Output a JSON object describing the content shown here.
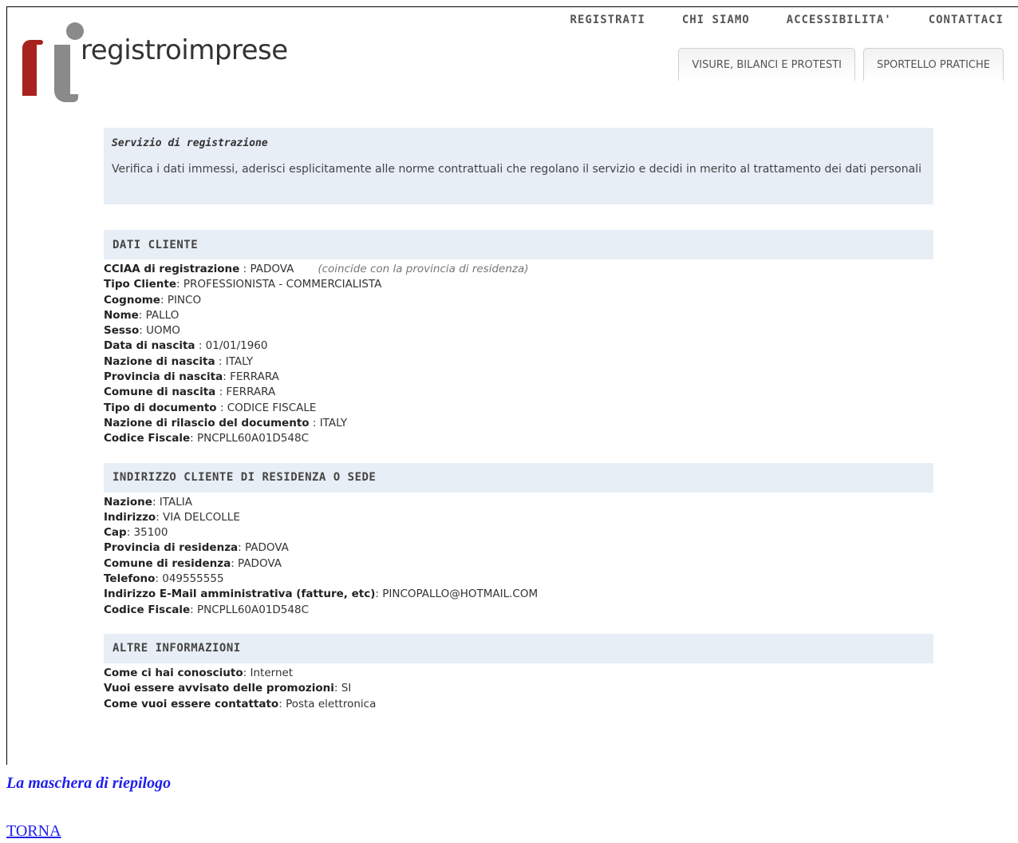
{
  "logo": {
    "text": "registroimprese",
    "colors": {
      "red": "#a8231e",
      "grey": "#8a8a8a"
    }
  },
  "topnav": [
    "REGISTRATI",
    "CHI SIAMO",
    "ACCESSIBILITA'",
    "CONTATTACI"
  ],
  "tabs": [
    "VISURE, BILANCI E PROTESTI",
    "SPORTELLO PRATICHE"
  ],
  "intro": {
    "title": "Servizio di registrazione",
    "text": "Verifica i dati immessi, aderisci esplicitamente alle norme contrattuali che regolano il servizio e decidi in merito al trattamento dei dati personali"
  },
  "sections": [
    {
      "title": "DATI CLIENTE",
      "rows": [
        {
          "label": "CCIAA di registrazione",
          "sep": " : ",
          "value": "PADOVA",
          "note": "(coincide con la provincia di residenza)"
        },
        {
          "label": "Tipo Cliente",
          "sep": ": ",
          "value": "PROFESSIONISTA - COMMERCIALISTA"
        },
        {
          "label": "Cognome",
          "sep": ": ",
          "value": "PINCO"
        },
        {
          "label": "Nome",
          "sep": ": ",
          "value": "PALLO"
        },
        {
          "label": "Sesso",
          "sep": ": ",
          "value": "UOMO"
        },
        {
          "label": "Data di nascita",
          "sep": " : ",
          "value": "01/01/1960"
        },
        {
          "label": "Nazione di nascita",
          "sep": " : ",
          "value": "ITALY"
        },
        {
          "label": "Provincia di nascita",
          "sep": ": ",
          "value": "FERRARA"
        },
        {
          "label": "Comune di nascita",
          "sep": " : ",
          "value": "FERRARA"
        },
        {
          "label": "Tipo di documento",
          "sep": " : ",
          "value": "CODICE FISCALE"
        },
        {
          "label": "Nazione di rilascio del documento",
          "sep": " : ",
          "value": "ITALY"
        },
        {
          "label": "Codice Fiscale",
          "sep": ": ",
          "value": "PNCPLL60A01D548C"
        }
      ]
    },
    {
      "title": "INDIRIZZO CLIENTE DI RESIDENZA O SEDE",
      "rows": [
        {
          "label": "Nazione",
          "sep": ": ",
          "value": "ITALIA"
        },
        {
          "label": "Indirizzo",
          "sep": ": ",
          "value": "VIA DELCOLLE"
        },
        {
          "label": "Cap",
          "sep": ": ",
          "value": "35100"
        },
        {
          "label": "Provincia di residenza",
          "sep": ": ",
          "value": "PADOVA"
        },
        {
          "label": "Comune di residenza",
          "sep": ": ",
          "value": "PADOVA"
        },
        {
          "label": "Telefono",
          "sep": ": ",
          "value": "049555555"
        },
        {
          "label": "Indirizzo E-Mail amministrativa (fatture, etc)",
          "sep": ": ",
          "value": "PINCOPALLO@HOTMAIL.COM"
        },
        {
          "label": "Codice Fiscale",
          "sep": ": ",
          "value": "PNCPLL60A01D548C"
        }
      ]
    },
    {
      "title": "ALTRE INFORMAZIONI",
      "rows": [
        {
          "label": "Come ci hai conosciuto",
          "sep": ": ",
          "value": "Internet"
        },
        {
          "label": "Vuoi essere avvisato delle promozioni",
          "sep": ": ",
          "value": "SI"
        },
        {
          "label": "Come vuoi essere contattato",
          "sep": ": ",
          "value": "Posta elettronica"
        }
      ]
    }
  ],
  "caption": "La maschera di riepilogo",
  "back_link": "TORNA"
}
